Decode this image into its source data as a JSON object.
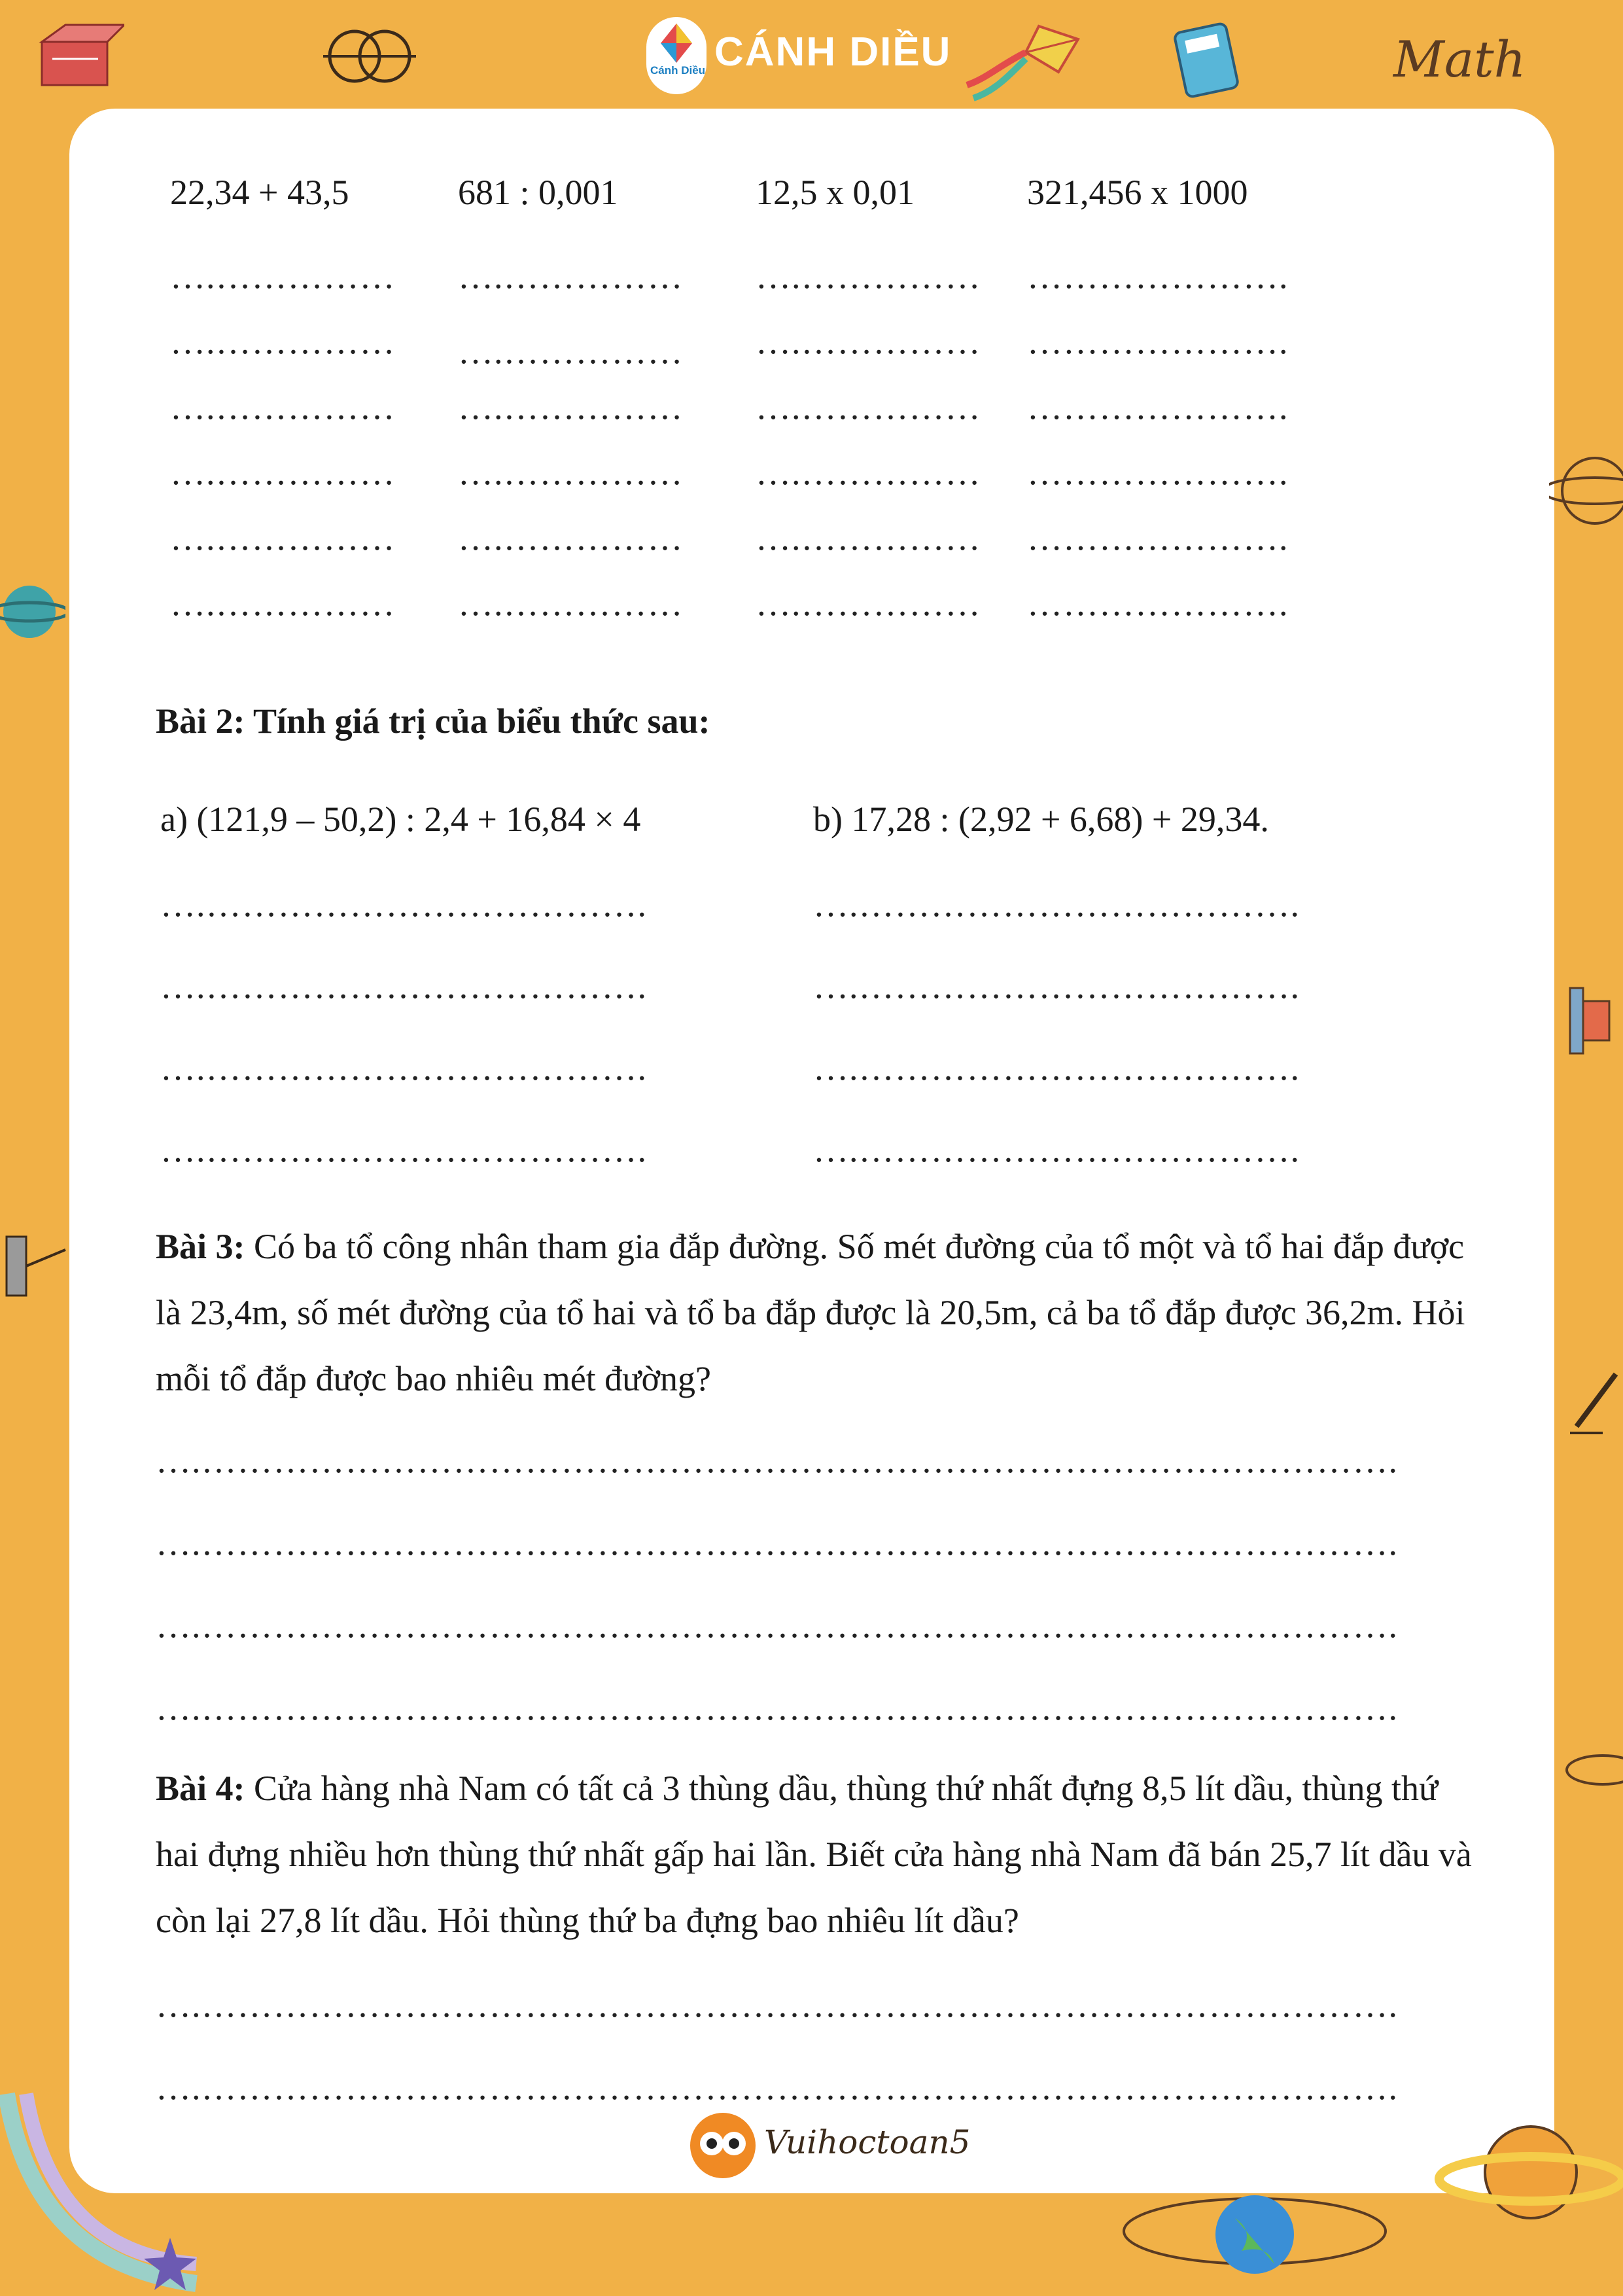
{
  "header": {
    "brand": "CÁNH DIỀU",
    "logo_text": "Cánh Diều",
    "math_word": "Math"
  },
  "bai1": {
    "calc1": "22,34 + 43,5",
    "calc2": "681 : 0,001",
    "calc3": "12,5 x 0,01",
    "calc4": "321,456 x 1000",
    "dot_line": "….……………",
    "dot_line_long": "…………………."
  },
  "bai2": {
    "label": "Bài 2: Tính giá trị của biểu thức sau:",
    "expr_a": "a) (121,9 – 50,2) : 2,4 + 16,84 × 4",
    "expr_b": "b) 17,28 : (2,92 + 6,68) + 29,34.",
    "dot_line": "….………………………………."
  },
  "bai3": {
    "label": "Bài 3:",
    "text": " Có ba tổ công nhân tham gia đắp đường. Số mét đường của tổ một và tổ hai đắp được là 23,4m, số mét đường của tổ hai và tổ ba đắp được là 20,5m, cả ba tổ đắp được 36,2m. Hỏi mỗi tổ đắp được bao nhiêu mét đường?"
  },
  "bai4": {
    "label": "Bài 4:",
    "text": " Cửa hàng nhà Nam có tất cả 3 thùng dầu, thùng thứ nhất đựng 8,5 lít dầu, thùng thứ hai đựng nhiều hơn thùng thứ nhất gấp hai lần. Biết cửa hàng nhà Nam đã bán 25,7 lít dầu và còn lại 27,8 lít dầu. Hỏi thùng thứ ba đựng bao nhiêu lít dầu?"
  },
  "answer_line": "….……………………………………………………………………………………….",
  "footer": {
    "brand": "Vuihoctoan5"
  },
  "colors": {
    "border": "#F1B147",
    "page": "#ffffff",
    "text": "#1a1a1a"
  }
}
